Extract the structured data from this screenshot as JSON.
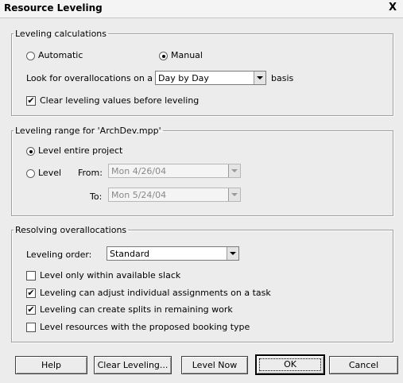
{
  "window": {
    "title": "Resource Leveling",
    "close_glyph": "X"
  },
  "calc": {
    "legend": "Leveling calculations",
    "automatic_label": "Automatic",
    "manual_label": "Manual",
    "selected": "manual",
    "look_for_label": "Look for overallocations on a",
    "basis_value": "Day by Day",
    "basis_suffix": "basis",
    "clear_values_label": "Clear leveling values before leveling",
    "clear_values_checked": true
  },
  "range": {
    "legend": "Leveling range for 'ArchDev.mpp'",
    "entire_label": "Level entire project",
    "level_label": "Level",
    "selected": "entire",
    "from_label": "From:",
    "from_value": "Mon 4/26/04",
    "to_label": "To:",
    "to_value": "Mon 5/24/04"
  },
  "resolve": {
    "legend": "Resolving overallocations",
    "order_label": "Leveling order:",
    "order_value": "Standard",
    "options": [
      {
        "label": "Level only within available slack",
        "checked": false
      },
      {
        "label": "Leveling can adjust individual assignments on a task",
        "checked": true
      },
      {
        "label": "Leveling can create splits in remaining work",
        "checked": true
      },
      {
        "label": "Level resources with the proposed booking type",
        "checked": false
      }
    ]
  },
  "buttons": {
    "help": "Help",
    "clear": "Clear Leveling...",
    "level_now": "Level Now",
    "ok": "OK",
    "cancel": "Cancel"
  },
  "icons": {
    "checked": "✔",
    "close": "close-icon"
  }
}
